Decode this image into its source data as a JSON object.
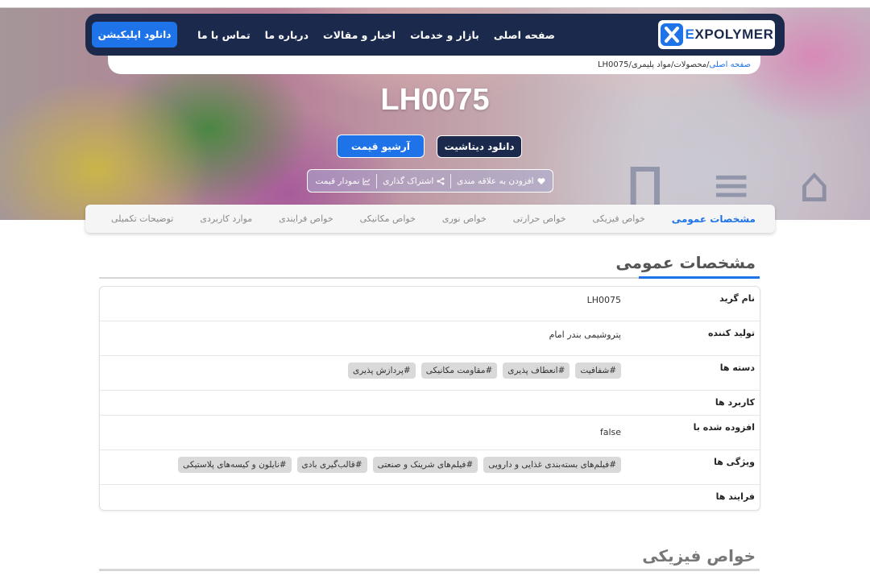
{
  "header": {
    "logo_text_x": "",
    "logo_text_e": "E",
    "logo_text_rest": "XPOLYMER",
    "nav": [
      "صفحه اصلی",
      "بازار و خدمات",
      "اخبار و مقالات",
      "درباره ما",
      "تماس با ما"
    ],
    "app_button": "دانلود اپلیکیشن"
  },
  "breadcrumb": {
    "home": "صفحه اصلی",
    "rest": " /محصولات/مواد پلیمری/LH0075"
  },
  "hero": {
    "title": "LH0075",
    "datasheet_button": "دانلود دیتاشیت",
    "archive_button": "آرشیو قیمت",
    "actions": {
      "favorite": "افزودن به علاقه مندی",
      "share": "اشتراک گذاری",
      "chart": "نمودار قیمت"
    }
  },
  "tabs": [
    "مشخصات عمومی",
    "خواص فیزیکی",
    "خواص حرارتی",
    "خواص نوری",
    "خواص مکانیکی",
    "خواص فرایندی",
    "موارد کاربردی",
    "توضیحات تکمیلی"
  ],
  "general": {
    "title": "مشخصات عمومی",
    "rows": {
      "grade": {
        "label": "نام گرید",
        "value": "LH0075"
      },
      "producer": {
        "label": "تولید کننده",
        "value": "پتروشیمی بندر امام"
      },
      "categories": {
        "label": "دسته ها",
        "tags": [
          "#شفافیت",
          "#انعطاف پذیری",
          "#مقاومت مکانیکی",
          "#پردازش پذیری"
        ]
      },
      "applications": {
        "label": "کاربرد ها"
      },
      "added_by": {
        "label": "افزوده شده با",
        "value": "false"
      },
      "features": {
        "label": "ویژگی ها",
        "tags": [
          "#فیلم‌های بسته‌بندی غذایی و دارویی",
          "#فیلم‌های شرینک و صنعتی",
          "#قالب‌گیری بادی",
          "#نایلون و کیسه‌های پلاستیکی"
        ]
      },
      "processes": {
        "label": "فرایند ها"
      }
    }
  },
  "physical": {
    "title": "خواص فیزیکی"
  },
  "colors": {
    "navy": "#1b2a4c",
    "blue": "#1e73e8",
    "tag_bg": "#d9d9d9"
  }
}
